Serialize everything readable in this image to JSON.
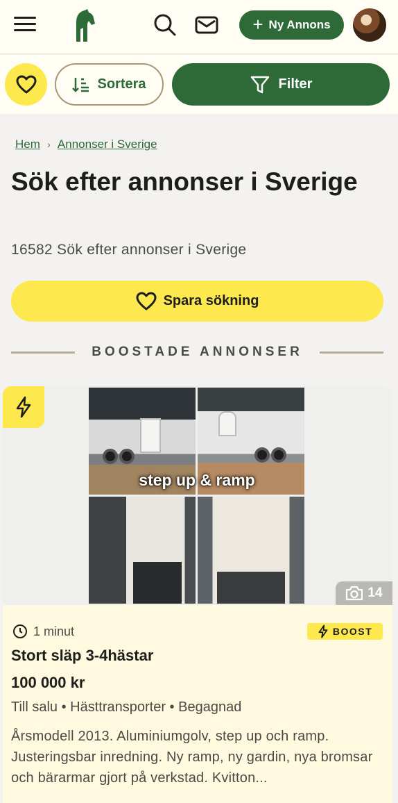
{
  "nav": {
    "new_ad_label": "Ny Annons"
  },
  "actionbar": {
    "sort_label": "Sortera",
    "filter_label": "Filter"
  },
  "breadcrumb": {
    "items": [
      "Hem",
      "Annonser i Sverige"
    ]
  },
  "page": {
    "title": "Sök efter annonser i Sverige",
    "result_count": "16582 Sök efter annonser i Sverige",
    "save_search_label": "Spara sökning",
    "section_heading": "BOOSTADE ANNONSER"
  },
  "listing": {
    "image_caption": "step up & ramp",
    "photo_count": "14",
    "time": "1 minut",
    "boost_label": "BOOST",
    "title": "Stort släp 3-4hästar",
    "price": "100 000 kr",
    "tags": "Till salu • Hästtransporter • Begagnad",
    "description": "Årsmodell 2013. Aluminiumgolv, step up och ramp. Justeringsbar inredning. Ny ramp, ny gardin, nya bromsar och bärarmar gjort på verkstad. Kvitton..."
  },
  "colors": {
    "brand_green": "#2d6a38",
    "accent_yellow": "#fde84d",
    "cream": "#fffdf4"
  },
  "icons": [
    "menu-icon",
    "horse-logo",
    "search-icon",
    "mail-icon",
    "plus-icon",
    "heart-icon",
    "sort-icon",
    "filter-icon",
    "chevron-right-icon",
    "bolt-icon",
    "camera-icon",
    "clock-icon"
  ]
}
